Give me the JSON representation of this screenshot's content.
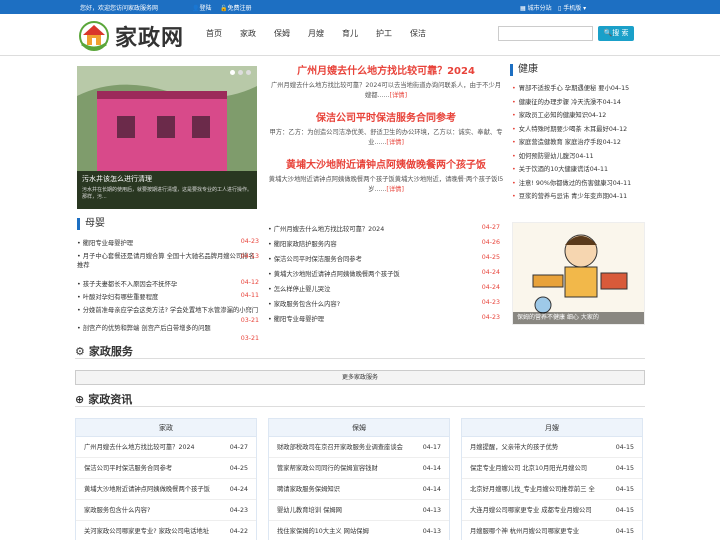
{
  "topbar": {
    "welcome": "您好，欢迎您访问家政服务网",
    "login": "登陆",
    "register": "免费注册",
    "city": "城市分站",
    "mobile": "手机版"
  },
  "logo": {
    "text": "家政网"
  },
  "nav": [
    "首页",
    "家政",
    "保姆",
    "月嫂",
    "育儿",
    "护工",
    "保洁"
  ],
  "search": {
    "button": "搜 索",
    "placeholder": ""
  },
  "slider": {
    "title": "污水井该怎么进行清理",
    "desc": "污水井在长期的使用后，就要按期进行清理，这是要找专业的工人进行操作。那样，污..."
  },
  "headlines": [
    {
      "title": "广州月嫂去什么地方找比较可靠？2024",
      "desc": "广州月嫂去什么地方找比较可靠？2024可以去当地街道办询问联系人，由于不少月嫂都......",
      "more": "[详情]"
    },
    {
      "title": "保洁公司平时保洁服务合同参考",
      "desc": "甲方：乙方：为创造公司洁净优美、舒适卫生的办公环境，乙方以：诚实、奉献、专业......",
      "more": "[详情]"
    },
    {
      "title": "黄埔大沙地附近请钟点阿姨做晚餐两个孩子饭",
      "desc": "黄埔大沙地附近请钟点阿姨做晚餐两个孩子饭黄埔大沙地附近，请晚餐·两个孩子饭l5岁......",
      "more": "[详情]"
    }
  ],
  "health": {
    "title": "健康",
    "items": [
      "胃部不适按手心 孕期遇便秘 要小04-15",
      "健康征的办理步骤 冷天洗澡不04-14",
      "家政员工必知的健康知识04-12",
      "女人特殊时期要少喝茶 木耳最好04-12",
      "家庭营造健教育 家庭治疗手段04-12",
      "如何预防婴幼儿腹泻04-11",
      "关于饮酒的10大健康谎话04-11",
      "注意! 90%你都做过的伤害健康习04-11",
      "豆浆的营养与忌讳 青少年变声期04-11"
    ]
  },
  "cartoon": {
    "caption": "保姆的营养不健康 细心 大家的"
  },
  "baby": {
    "title": "母婴",
    "items": [
      {
        "t": "衢阳专业母婴护理",
        "d": "04-23"
      },
      {
        "t": "月子中心套餐还是请月嫂合算 全国十大驰名品牌月嫂公司排名推荐",
        "d": "04-13"
      },
      {
        "t": "孩子夫妻都长不入原因会不抚怀孕",
        "d": "04-12"
      },
      {
        "t": "叶酸对孕妇有哪些重要程度",
        "d": "04-11"
      },
      {
        "t": "分娩前准母亲应学会这类方法? 学会处置地下水管渗漏的小窍门",
        "d": "03-21"
      },
      {
        "t": "剖宫产的优势和弊端 剖宫产后白带增多的问题",
        "d": "03-21"
      }
    ]
  },
  "news": [
    {
      "t": "广州月嫂去什么地方找比较可靠？2024",
      "d": "04-27"
    },
    {
      "t": "衢阳家政陪护服务内容",
      "d": "04-26"
    },
    {
      "t": "保洁公司平时保洁服务合同参考",
      "d": "04-25"
    },
    {
      "t": "黄埔大沙地附近请钟点阿姨做晚餐两个孩子饭",
      "d": "04-24"
    },
    {
      "t": "怎么样停止婴儿哭泣",
      "d": "04-24"
    },
    {
      "t": "家政服务包含什么内容?",
      "d": "04-23"
    },
    {
      "t": "衢阳专业母婴护理",
      "d": "04-23"
    }
  ],
  "service": {
    "title": "家政服务",
    "more": "更多家政服务"
  },
  "info": {
    "title": "家政资讯",
    "columns": [
      {
        "head": "家政",
        "rows": [
          {
            "t": "广州月嫂去什么地方找比较可靠？2024",
            "d": "04-27"
          },
          {
            "t": "保洁公司平时保洁服务合同参考",
            "d": "04-25"
          },
          {
            "t": "黄埔大沙地附近请钟点阿姨做晚餐两个孩子饭",
            "d": "04-24"
          },
          {
            "t": "家政服务包含什么内容?",
            "d": "04-23"
          },
          {
            "t": "关河家政公司哪家更专业? 家政公司电话地址",
            "d": "04-22"
          }
        ]
      },
      {
        "head": "保姆",
        "rows": [
          {
            "t": "财政部税政司在京召开家政服务业调查座谈会",
            "d": "04-17"
          },
          {
            "t": "管家帮家政公司同行的保姆宣容钱财",
            "d": "04-14"
          },
          {
            "t": "聘请家政服务保姆知识",
            "d": "04-14"
          },
          {
            "t": "婴幼儿教育培训 保姆网",
            "d": "04-13"
          },
          {
            "t": "找住家保姆的10大主义 网站保姆",
            "d": "04-13"
          }
        ]
      },
      {
        "head": "月嫂",
        "rows": [
          {
            "t": "月嫂提醒，父亲带大的孩子优势",
            "d": "04-15"
          },
          {
            "t": "保定专业月嫂公司 北京10月阳光月嫂公司",
            "d": "04-15"
          },
          {
            "t": "北京好月嫂哪儿找_专业月嫂公司推荐前三 全",
            "d": "04-15"
          },
          {
            "t": "大连月嫂公司哪家更专业 成都专业月嫂公司",
            "d": "04-15"
          },
          {
            "t": "月嫂服哪个神 杭州月嫂公司哪家更专业",
            "d": "04-15"
          }
        ]
      }
    ]
  },
  "colors": {
    "brand": "#1d6fc2",
    "accent": "#e8433a",
    "search": "#1aa0c9"
  }
}
